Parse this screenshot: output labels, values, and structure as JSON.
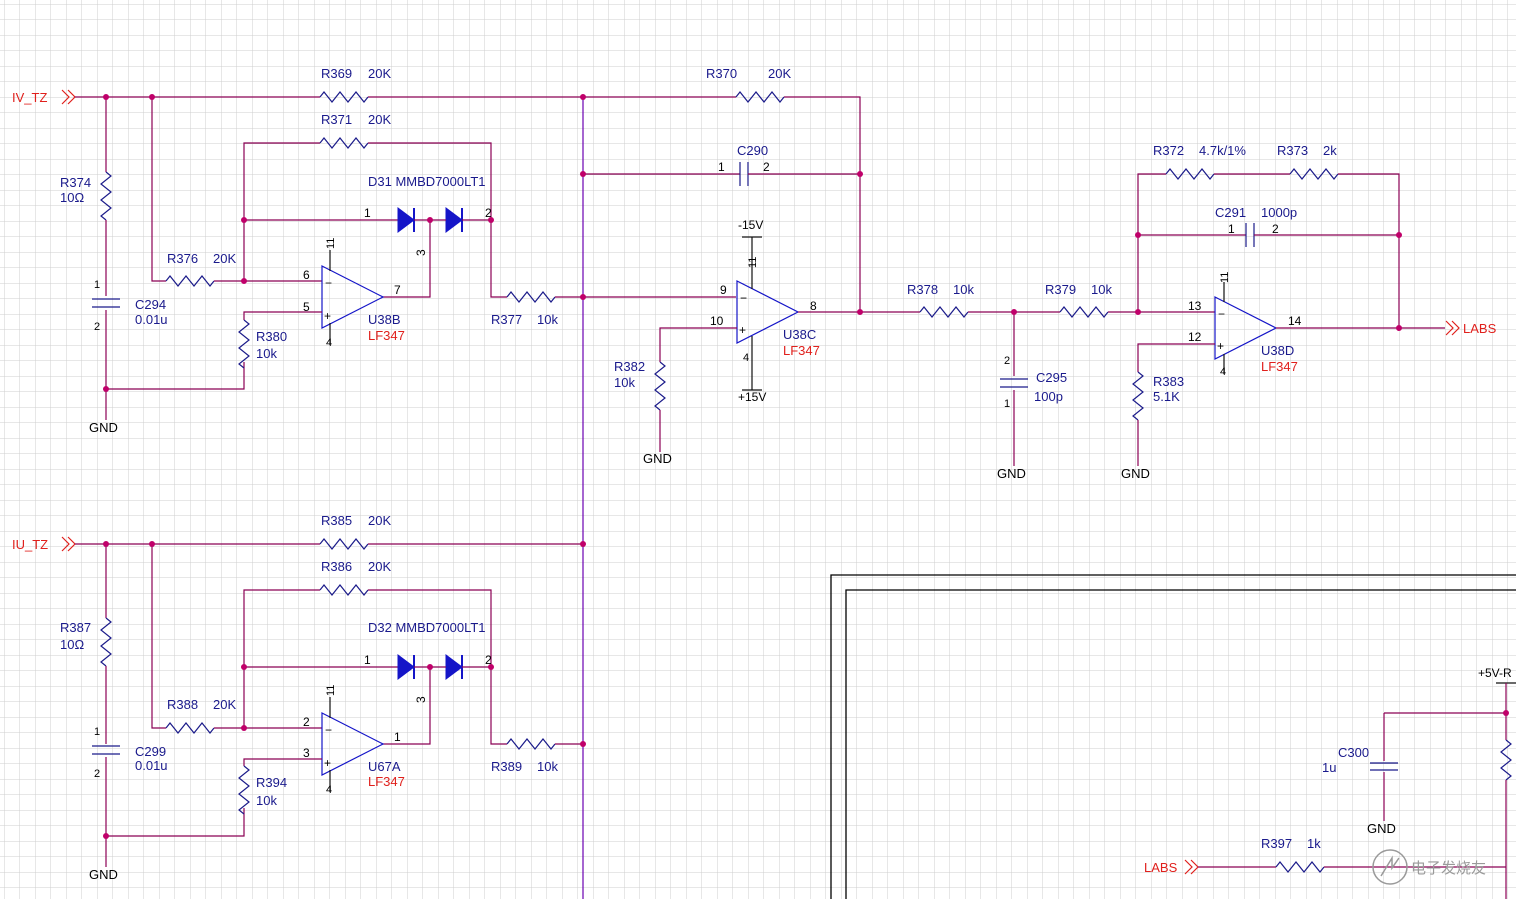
{
  "nets": {
    "iv_tz": "IV_TZ",
    "iu_tz": "IU_TZ",
    "labs_out": "LABS",
    "labs_in": "LABS",
    "gnd": "GND",
    "neg15": "-15V",
    "pos15": "+15V",
    "pos5": "+5V-R"
  },
  "resistors": {
    "r369": {
      "ref": "R369",
      "value": "20K"
    },
    "r370": {
      "ref": "R370",
      "value": "20K"
    },
    "r371": {
      "ref": "R371",
      "value": "20K"
    },
    "r374": {
      "ref": "R374",
      "value": "10Ω"
    },
    "r376": {
      "ref": "R376",
      "value": "20K"
    },
    "r377": {
      "ref": "R377",
      "value": "10k"
    },
    "r380": {
      "ref": "R380",
      "value": "10k"
    },
    "r382": {
      "ref": "R382",
      "value": "10k"
    },
    "r378": {
      "ref": "R378",
      "value": "10k"
    },
    "r379": {
      "ref": "R379",
      "value": "10k"
    },
    "r372": {
      "ref": "R372",
      "value": "4.7k/1%"
    },
    "r373": {
      "ref": "R373",
      "value": "2k"
    },
    "r383": {
      "ref": "R383",
      "value": "5.1K"
    },
    "r385": {
      "ref": "R385",
      "value": "20K"
    },
    "r386": {
      "ref": "R386",
      "value": "20K"
    },
    "r387": {
      "ref": "R387",
      "value": "10Ω"
    },
    "r388": {
      "ref": "R388",
      "value": "20K"
    },
    "r389": {
      "ref": "R389",
      "value": "10k"
    },
    "r394": {
      "ref": "R394",
      "value": "10k"
    },
    "r397": {
      "ref": "R397",
      "value": "1k"
    }
  },
  "capacitors": {
    "c290": {
      "ref": "C290"
    },
    "c291": {
      "ref": "C291",
      "value": "1000p"
    },
    "c294": {
      "ref": "C294",
      "value": "0.01u"
    },
    "c295": {
      "ref": "C295",
      "value": "100p"
    },
    "c299": {
      "ref": "C299",
      "value": "0.01u"
    },
    "c300": {
      "ref": "C300",
      "value": "1u"
    }
  },
  "diodes": {
    "d31": {
      "label": "D31 MMBD7000LT1"
    },
    "d32": {
      "label": "D32 MMBD7000LT1"
    }
  },
  "opamps": {
    "u38b": {
      "ref": "U38B",
      "part": "LF347"
    },
    "u38c": {
      "ref": "U38C",
      "part": "LF347"
    },
    "u38d": {
      "ref": "U38D",
      "part": "LF347"
    },
    "u67a": {
      "ref": "U67A",
      "part": "LF347"
    }
  },
  "pins": {
    "p1": "1",
    "p2": "2",
    "p3": "3",
    "p4": "4",
    "p5": "5",
    "p6": "6",
    "p7": "7",
    "p8": "8",
    "p9": "9",
    "p10": "10",
    "p11": "11",
    "p12": "12",
    "p13": "13",
    "p14": "14"
  },
  "watermark": "电子发烧友"
}
